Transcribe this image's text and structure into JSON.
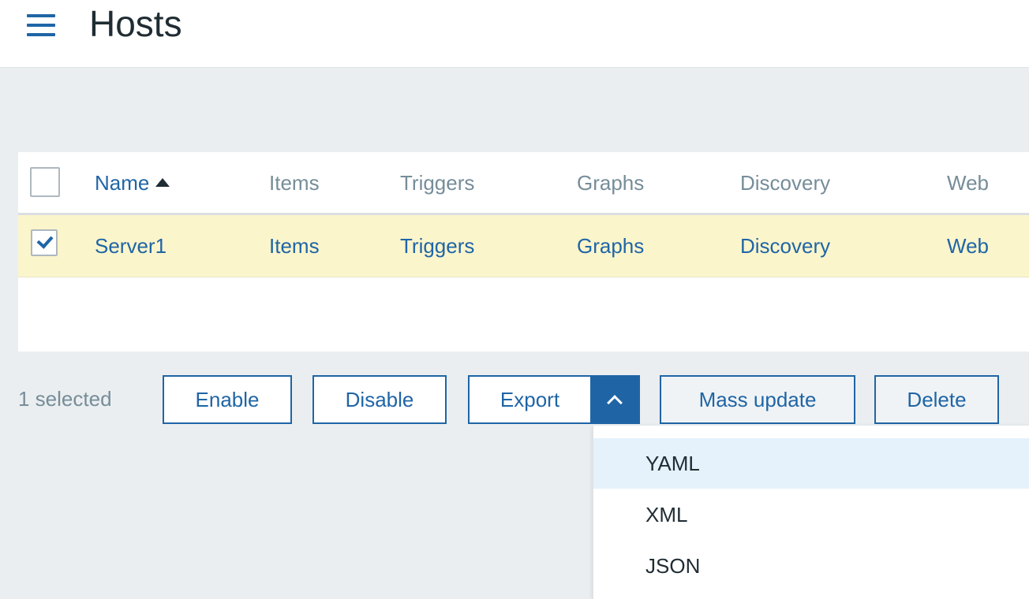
{
  "header": {
    "title": "Hosts",
    "menu_icon": "hamburger-menu-icon"
  },
  "table": {
    "columns": [
      {
        "label": "Name",
        "sortable": true,
        "sort": "ascending"
      },
      {
        "label": "Items"
      },
      {
        "label": "Triggers"
      },
      {
        "label": "Graphs"
      },
      {
        "label": "Discovery"
      },
      {
        "label": "Web"
      }
    ],
    "rows": [
      {
        "checked": true,
        "name": "Server1",
        "items": "Items",
        "triggers": "Triggers",
        "graphs": "Graphs",
        "discovery": "Discovery",
        "web": "Web"
      }
    ]
  },
  "actions": {
    "selected_count": "1 selected",
    "enable": "Enable",
    "disable": "Disable",
    "export": "Export",
    "mass_update": "Mass update",
    "delete": "Delete"
  },
  "export_menu": {
    "items": [
      "YAML",
      "XML",
      "JSON"
    ],
    "highlighted": "YAML"
  },
  "colors": {
    "accent": "#1f65a6",
    "selected_row": "#fbf5cc",
    "menu_highlight": "#e5f1fb",
    "muted_text": "#768d99"
  }
}
